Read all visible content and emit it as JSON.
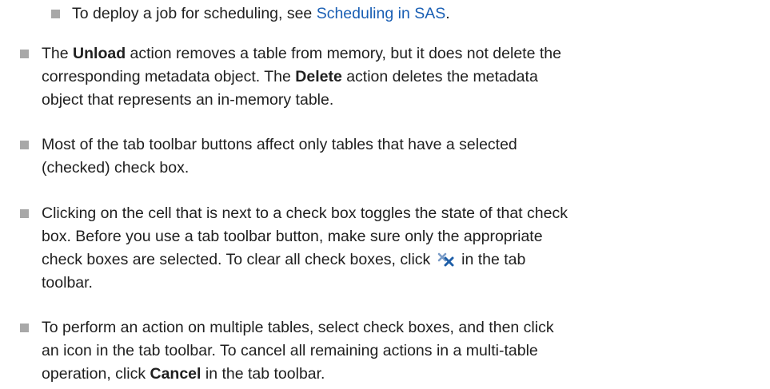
{
  "bullets": {
    "item0": {
      "pre": "To deploy a job for scheduling, see ",
      "link": "Scheduling in SAS",
      "post": "."
    },
    "item1": {
      "l1_a": "The ",
      "l1_b": "Unload",
      "l1_c": " action removes a table from memory, but it does not delete the",
      "l2_a": "corresponding metadata object. The ",
      "l2_b": "Delete",
      "l2_c": " action deletes the metadata",
      "l3": "object that represents an in-memory table."
    },
    "item2": {
      "l1": "Most of the tab toolbar buttons affect only tables that have a selected",
      "l2": "(checked) check box."
    },
    "item3": {
      "l1": "Clicking on the cell that is next to a check box toggles the state of that check",
      "l2": "box. Before you use a tab toolbar button, make sure only the appropriate",
      "l3_a": "check boxes are selected. To clear all check boxes, click",
      "l3_b": "in the tab",
      "l4": "toolbar."
    },
    "item4": {
      "l1": "To perform an action on multiple tables, select check boxes, and then click",
      "l2": "an icon in the tab toolbar. To cancel all remaining actions in a multi-table",
      "l3_a": "operation, click ",
      "l3_b": "Cancel",
      "l3_c": " in the tab toolbar."
    }
  },
  "icons": {
    "clear_checkboxes": "clear-all-checkboxes-icon"
  },
  "colors": {
    "link": "#1a5fb4",
    "bullet": "#a8a8a8",
    "icon_blue": "#1f5fa8"
  }
}
